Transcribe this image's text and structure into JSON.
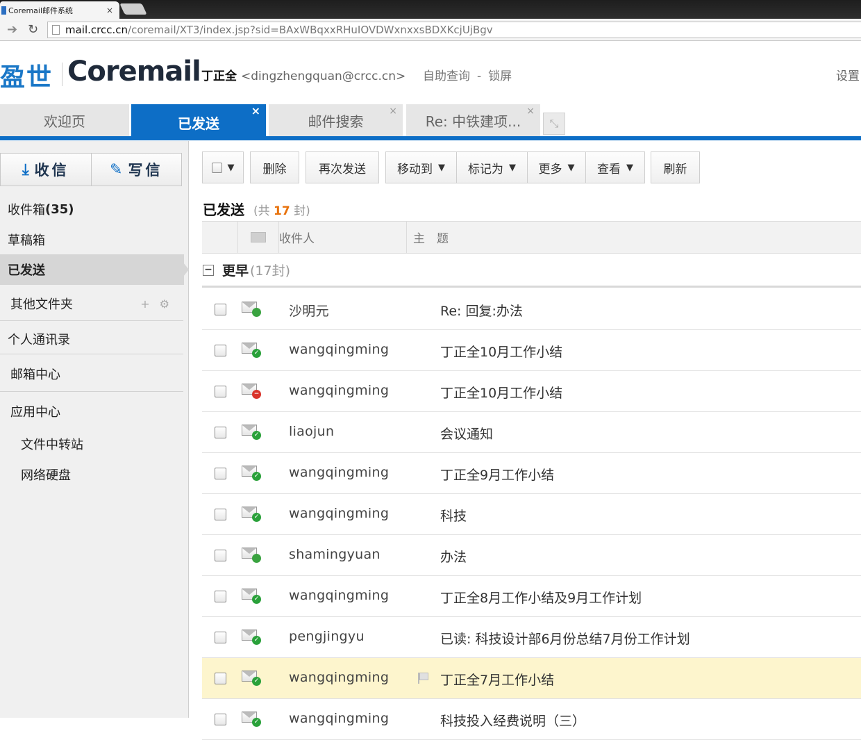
{
  "browser": {
    "tab_title": "Coremail邮件系统",
    "tab_close": "×",
    "url_domain": "mail.crcc.cn",
    "url_path": "/coremail/XT3/index.jsp?sid=BAxWBqxxRHuIOVDWxnxxsBDXKcjUjBgv"
  },
  "header": {
    "logo_cn": "盈世",
    "logo_en": "Coremail",
    "user_name": "丁正全",
    "user_email": "<dingzhengquan@crcc.cn>",
    "self_service": "自助查询",
    "separator": "-",
    "lock": "锁屏",
    "settings": "设置"
  },
  "tabs": [
    {
      "label": "欢迎页",
      "close": ""
    },
    {
      "label": "已发送",
      "close": "×"
    },
    {
      "label": "邮件搜索",
      "close": "×"
    },
    {
      "label": "Re: 中铁建项...",
      "close": "×"
    }
  ],
  "sidebar": {
    "receive": "收信",
    "compose": "写信",
    "inbox_label": "收件箱",
    "inbox_count": "(35)",
    "drafts": "草稿箱",
    "sent": "已发送",
    "other_folders": "其他文件夹",
    "contacts": "个人通讯录",
    "mailbox_center": "邮箱中心",
    "app_center": "应用中心",
    "file_transfer": "文件中转站",
    "network_disk": "网络硬盘"
  },
  "toolbar": {
    "delete": "删除",
    "resend": "再次发送",
    "move_to": "移动到",
    "mark_as": "标记为",
    "more": "更多",
    "view": "查看",
    "refresh": "刷新"
  },
  "folder_title": {
    "name": "已发送",
    "prefix": "(共",
    "count": "17",
    "suffix": "封)"
  },
  "list_header": {
    "recipient": "收件人",
    "subject": "主　题"
  },
  "group": {
    "toggle": "−",
    "label": "更早",
    "count": "(17封)"
  },
  "emails": [
    {
      "recipient": "沙明元",
      "subject": "Re: 回复:办法",
      "status": "bar"
    },
    {
      "recipient": "wangqingming",
      "subject": "丁正全10月工作小结",
      "status": "ok"
    },
    {
      "recipient": "wangqingming",
      "subject": "丁正全10月工作小结",
      "status": "err"
    },
    {
      "recipient": "liaojun",
      "subject": "会议通知",
      "status": "ok"
    },
    {
      "recipient": "wangqingming",
      "subject": "丁正全9月工作小结",
      "status": "ok"
    },
    {
      "recipient": "wangqingming",
      "subject": "科技",
      "status": "ok"
    },
    {
      "recipient": "shamingyuan",
      "subject": "办法",
      "status": "bar"
    },
    {
      "recipient": "wangqingming",
      "subject": "丁正全8月工作小结及9月工作计划",
      "status": "ok"
    },
    {
      "recipient": "pengjingyu",
      "subject": "已读: 科技设计部6月份总结7月份工作计划",
      "status": "ok"
    },
    {
      "recipient": "wangqingming",
      "subject": "丁正全7月工作小结",
      "status": "ok",
      "highlight": true,
      "flag": true
    },
    {
      "recipient": "wangqingming",
      "subject": "科技投入经费说明（三）",
      "status": "ok"
    }
  ]
}
